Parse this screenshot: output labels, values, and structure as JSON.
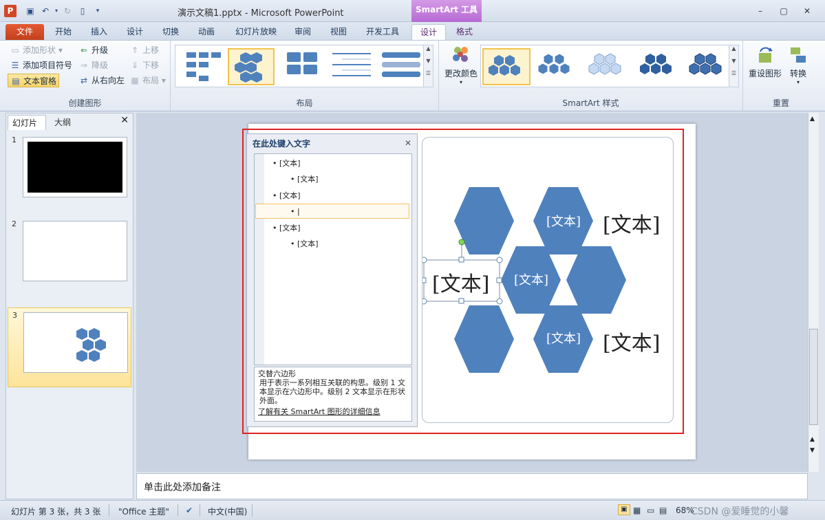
{
  "title_bar": {
    "app_logo": "P",
    "window_title": "演示文稿1.pptx - Microsoft PowerPoint",
    "context_title": "SmartArt 工具"
  },
  "tabs": {
    "file": "文件",
    "items": [
      "开始",
      "插入",
      "设计",
      "切换",
      "动画",
      "幻灯片放映",
      "审阅",
      "视图",
      "开发工具"
    ],
    "ctx_design": "设计",
    "ctx_format": "格式"
  },
  "ribbon": {
    "create": {
      "label": "创建图形",
      "add_shape": "添加形状",
      "add_bullet": "添加项目符号",
      "text_pane": "文本窗格",
      "promote": "升级",
      "demote": "降级",
      "rtl": "从右向左",
      "move_up": "上移",
      "move_down": "下移",
      "layout": "布局"
    },
    "layouts_label": "布局",
    "change_colors": "更改颜色",
    "styles_label": "SmartArt 样式",
    "reset": {
      "label": "重置",
      "reset_graphic": "重设图形",
      "convert": "转换"
    }
  },
  "left_panel": {
    "tab_slides": "幻灯片",
    "tab_outline": "大纲",
    "close": "✕",
    "slide_numbers": [
      "1",
      "2",
      "3"
    ]
  },
  "text_pane": {
    "title": "在此处键入文字",
    "close": "✕",
    "bullets": [
      {
        "level": 1,
        "text": "[文本]"
      },
      {
        "level": 2,
        "text": "[文本]"
      },
      {
        "level": 1,
        "text": "[文本]"
      },
      {
        "level": 2,
        "text": "|"
      },
      {
        "level": 1,
        "text": "[文本]"
      },
      {
        "level": 2,
        "text": "[文本]"
      }
    ],
    "desc_title": "交替六边形",
    "desc_body": "用于表示一系列相互关联的构思。级别 1 文本显示在六边形中。级别 2 文本显示在形状外面。",
    "desc_link": "了解有关 SmartArt 图形的详细信息"
  },
  "smartart": {
    "hex_labels": [
      "[文本]",
      "[文本]",
      "[文本]"
    ],
    "outer_labels": [
      "[文本]",
      "[文本]",
      "[文本]"
    ],
    "hex_color": "#4f81bd"
  },
  "notes": {
    "placeholder": "单击此处添加备注"
  },
  "status_bar": {
    "slide_info": "幻灯片 第 3 张，共 3 张",
    "theme": "\"Office 主题\"",
    "language": "中文(中国)",
    "zoom": "68%",
    "watermark": "CSDN @爱睡觉的小馨"
  },
  "colors": {
    "accent_red": "#e02222",
    "file_tab": "#d24726",
    "context_purple": "#b66ad4"
  }
}
